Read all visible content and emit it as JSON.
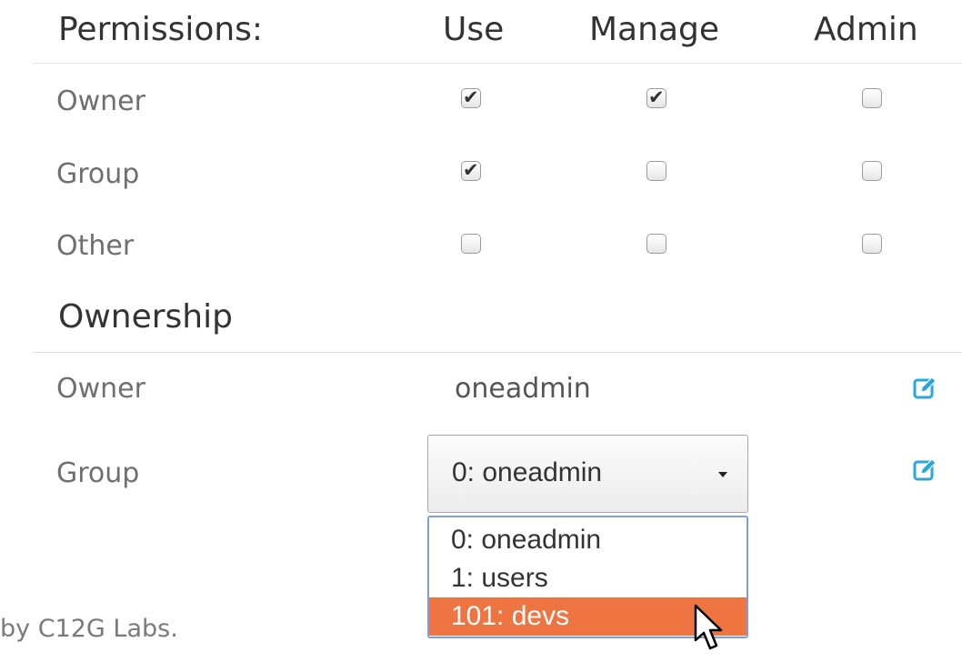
{
  "permissions": {
    "title": "Permissions:",
    "columns": {
      "use": "Use",
      "manage": "Manage",
      "admin": "Admin"
    },
    "rows": [
      {
        "label": "Owner",
        "use": true,
        "manage": true,
        "admin": false
      },
      {
        "label": "Group",
        "use": true,
        "manage": false,
        "admin": false
      },
      {
        "label": "Other",
        "use": false,
        "manage": false,
        "admin": false
      }
    ]
  },
  "ownership": {
    "title": "Ownership",
    "owner": {
      "label": "Owner",
      "value": "oneadmin",
      "edit_icon": "edit-icon"
    },
    "group": {
      "label": "Group",
      "selected": "0: oneadmin",
      "options": [
        "0: oneadmin",
        "1: users",
        "101: devs"
      ],
      "highlighted_option": "101: devs",
      "edit_icon": "edit-icon"
    }
  },
  "footer": {
    "text": "by C12G Labs."
  },
  "colors": {
    "accent": "#2aa7d8",
    "highlight": "#ee7542",
    "dropdown_border": "#7d9fd6"
  }
}
